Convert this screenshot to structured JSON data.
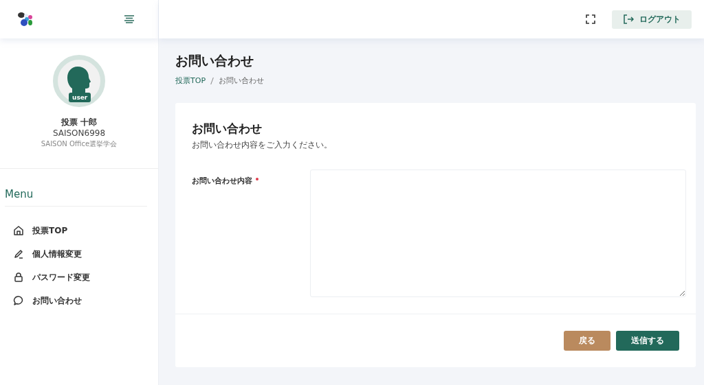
{
  "header": {
    "logout": "ログアウト"
  },
  "user": {
    "badge": "user",
    "name": "投票 十郎",
    "id": "SAISON6998",
    "org": "SAISON Office選挙学会"
  },
  "menu": {
    "title": "Menu",
    "items": [
      {
        "label": "投票TOP",
        "kind": "home"
      },
      {
        "label": "個人情報変更",
        "kind": "edit"
      },
      {
        "label": "パスワード変更",
        "kind": "password"
      },
      {
        "label": "お問い合わせ",
        "kind": "contact"
      }
    ]
  },
  "page": {
    "title": "お問い合わせ",
    "breadcrumb": [
      {
        "label": "投票TOP",
        "kind": "link"
      },
      {
        "label": "お問い合わせ",
        "kind": "current"
      }
    ]
  },
  "form": {
    "title": "お問い合わせ",
    "subtitle": "お問い合わせ内容をご入力ください。",
    "field": {
      "label": "お問い合わせ内容",
      "required": true
    },
    "buttons": [
      {
        "label": "戻る",
        "kind": "secondary"
      },
      {
        "label": "送信する",
        "kind": "primary"
      }
    ]
  }
}
